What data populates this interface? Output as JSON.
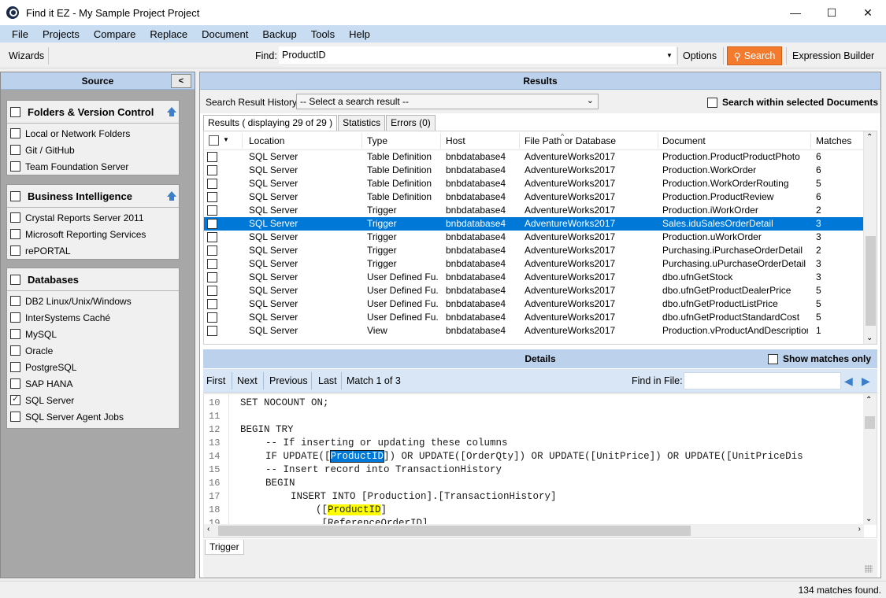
{
  "window": {
    "title": "Find it EZ - My Sample Project Project",
    "minimize": "—",
    "maximize": "☐",
    "close": "✕"
  },
  "menu": [
    "File",
    "Projects",
    "Compare",
    "Replace",
    "Document",
    "Backup",
    "Tools",
    "Help"
  ],
  "toolbar": {
    "wizards": "Wizards",
    "find_label": "Find:",
    "find_value": "ProductID",
    "options": "Options",
    "search": "Search",
    "expression_builder": "Expression Builder"
  },
  "source": {
    "title": "Source",
    "collapse": "<",
    "groups": [
      {
        "title": "Folders & Version Control",
        "items": [
          {
            "label": "Local or Network Folders",
            "checked": false
          },
          {
            "label": "Git / GitHub",
            "checked": false
          },
          {
            "label": "Team Foundation Server",
            "checked": false
          }
        ]
      },
      {
        "title": "Business Intelligence",
        "items": [
          {
            "label": "Crystal Reports Server 2011",
            "checked": false
          },
          {
            "label": "Microsoft Reporting Services",
            "checked": false
          },
          {
            "label": "rePORTAL",
            "checked": false
          }
        ]
      },
      {
        "title": "Databases",
        "items": [
          {
            "label": "DB2 Linux/Unix/Windows",
            "checked": false
          },
          {
            "label": "InterSystems Caché",
            "checked": false
          },
          {
            "label": "MySQL",
            "checked": false
          },
          {
            "label": "Oracle",
            "checked": false
          },
          {
            "label": "PostgreSQL",
            "checked": false
          },
          {
            "label": "SAP HANA",
            "checked": false
          },
          {
            "label": "SQL Server",
            "checked": true
          },
          {
            "label": "SQL Server Agent Jobs",
            "checked": false
          }
        ]
      }
    ]
  },
  "results": {
    "title": "Results",
    "history_label": "Search Result History:",
    "history_value": "-- Select a search result --",
    "within_docs": "Search within selected Documents",
    "tabs": [
      "Results ( displaying 29 of 29 )",
      "Statistics",
      "Errors (0)"
    ],
    "columns": [
      "Location",
      "Type",
      "Host",
      "File Path or Database",
      "Document",
      "Matches"
    ],
    "rows": [
      [
        "SQL Server",
        "Table Definition",
        "bnbdatabase4",
        "AdventureWorks2017",
        "Production.ProductProductPhoto",
        "6"
      ],
      [
        "SQL Server",
        "Table Definition",
        "bnbdatabase4",
        "AdventureWorks2017",
        "Production.WorkOrder",
        "6"
      ],
      [
        "SQL Server",
        "Table Definition",
        "bnbdatabase4",
        "AdventureWorks2017",
        "Production.WorkOrderRouting",
        "5"
      ],
      [
        "SQL Server",
        "Table Definition",
        "bnbdatabase4",
        "AdventureWorks2017",
        "Production.ProductReview",
        "6"
      ],
      [
        "SQL Server",
        "Trigger",
        "bnbdatabase4",
        "AdventureWorks2017",
        "Production.iWorkOrder",
        "2"
      ],
      [
        "SQL Server",
        "Trigger",
        "bnbdatabase4",
        "AdventureWorks2017",
        "Sales.iduSalesOrderDetail",
        "3"
      ],
      [
        "SQL Server",
        "Trigger",
        "bnbdatabase4",
        "AdventureWorks2017",
        "Production.uWorkOrder",
        "3"
      ],
      [
        "SQL Server",
        "Trigger",
        "bnbdatabase4",
        "AdventureWorks2017",
        "Purchasing.iPurchaseOrderDetail",
        "2"
      ],
      [
        "SQL Server",
        "Trigger",
        "bnbdatabase4",
        "AdventureWorks2017",
        "Purchasing.uPurchaseOrderDetail",
        "3"
      ],
      [
        "SQL Server",
        "User Defined Fu...",
        "bnbdatabase4",
        "AdventureWorks2017",
        "dbo.ufnGetStock",
        "3"
      ],
      [
        "SQL Server",
        "User Defined Fu...",
        "bnbdatabase4",
        "AdventureWorks2017",
        "dbo.ufnGetProductDealerPrice",
        "5"
      ],
      [
        "SQL Server",
        "User Defined Fu...",
        "bnbdatabase4",
        "AdventureWorks2017",
        "dbo.ufnGetProductListPrice",
        "5"
      ],
      [
        "SQL Server",
        "User Defined Fu...",
        "bnbdatabase4",
        "AdventureWorks2017",
        "dbo.ufnGetProductStandardCost",
        "5"
      ],
      [
        "SQL Server",
        "View",
        "bnbdatabase4",
        "AdventureWorks2017",
        "Production.vProductAndDescription",
        "1"
      ]
    ],
    "selected_row": 5
  },
  "details": {
    "title": "Details",
    "show_matches": "Show matches only",
    "first": "First",
    "next": "Next",
    "previous": "Previous",
    "last": "Last",
    "match_info": "Match 1 of 3",
    "find_in_file": "Find in File:",
    "code": [
      {
        "n": "10",
        "text": "SET NOCOUNT ON;",
        "indent": 0
      },
      {
        "n": "11",
        "text": "",
        "indent": 0
      },
      {
        "n": "12",
        "text": "BEGIN TRY",
        "indent": 0
      },
      {
        "n": "13",
        "text": "-- If inserting or updating these columns",
        "indent": 1
      },
      {
        "n": "14",
        "pre": "IF UPDATE([",
        "hl": "ProductID",
        "post": "]) OR UPDATE([OrderQty]) OR UPDATE([UnitPrice]) OR UPDATE([UnitPriceDis",
        "indent": 1,
        "hlkind": "sel"
      },
      {
        "n": "15",
        "text": "-- Insert record into TransactionHistory",
        "indent": 1
      },
      {
        "n": "16",
        "text": "BEGIN",
        "indent": 1
      },
      {
        "n": "17",
        "text": "INSERT INTO [Production].[TransactionHistory]",
        "indent": 2
      },
      {
        "n": "18",
        "pre": "([",
        "hl": "ProductID",
        "post": "]",
        "indent": 3,
        "hlkind": "yel"
      },
      {
        "n": "19",
        "text": " [ReferenceOrderID]",
        "indent": 3
      }
    ],
    "bottom_tab": "Trigger"
  },
  "status": {
    "matches_found": "134 matches found."
  }
}
